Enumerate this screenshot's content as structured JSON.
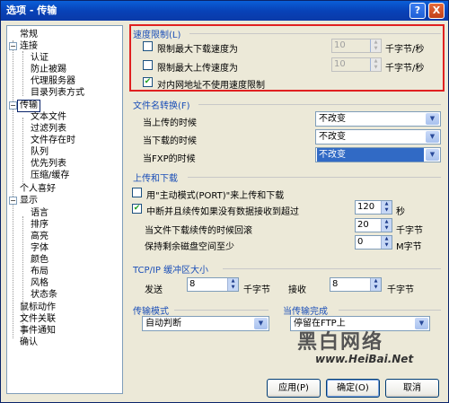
{
  "window": {
    "title": "选项 - 传输",
    "help_symbol": "?",
    "close_symbol": "X"
  },
  "tree": [
    {
      "label": "常规"
    },
    {
      "label": "连接"
    },
    {
      "label": "认证"
    },
    {
      "label": "防止被踢"
    },
    {
      "label": "代理服务器"
    },
    {
      "label": "目录列表方式"
    },
    {
      "label": "传输"
    },
    {
      "label": "文本文件"
    },
    {
      "label": "过滤列表"
    },
    {
      "label": "文件存在时"
    },
    {
      "label": "队列"
    },
    {
      "label": "优先列表"
    },
    {
      "label": "压缩/缓存"
    },
    {
      "label": "个人喜好"
    },
    {
      "label": "显示"
    },
    {
      "label": "语言"
    },
    {
      "label": "排序"
    },
    {
      "label": "高亮"
    },
    {
      "label": "字体"
    },
    {
      "label": "颜色"
    },
    {
      "label": "布局"
    },
    {
      "label": "风格"
    },
    {
      "label": "状态条"
    },
    {
      "label": "鼠标动作"
    },
    {
      "label": "文件关联"
    },
    {
      "label": "事件通知"
    },
    {
      "label": "确认"
    }
  ],
  "speed": {
    "title": "速度限制(L)",
    "max_download_label": "限制最大下载速度为",
    "max_download_value": "10",
    "max_upload_label": "限制最大上传速度为",
    "max_upload_value": "10",
    "unit": "千字节/秒",
    "no_limit_intranet_label": "对内网地址不使用速度限制",
    "max_download_checked": false,
    "max_upload_checked": false,
    "no_limit_intranet_checked": true
  },
  "conversion": {
    "title": "文件名转换(F)",
    "upload_label": "当上传的时候",
    "upload_value": "不改变",
    "download_label": "当下载的时候",
    "download_value": "不改变",
    "fxp_label": "当FXP的时候",
    "fxp_value": "不改变"
  },
  "transfer": {
    "title": "上传和下载",
    "active_mode_label": "用\"主动模式(PORT)\"来上传和下载",
    "active_mode_checked": false,
    "interrupt_label": "中断并且续传如果没有数据接收到超过",
    "interrupt_checked": true,
    "interrupt_value": "120",
    "interrupt_unit": "秒",
    "rollback_label": "当文件下载续传的时候回滚",
    "rollback_value": "20",
    "rollback_unit": "千字节",
    "reserve_label": "保持剩余磁盘空间至少",
    "reserve_value": "0",
    "reserve_unit": "M字节"
  },
  "buffer": {
    "title": "TCP/IP 缓冲区大小",
    "send_label": "发送",
    "send_value": "8",
    "send_unit": "千字节",
    "recv_label": "接收",
    "recv_value": "8",
    "recv_unit": "千字节"
  },
  "mode": {
    "title": "传输模式",
    "value": "自动判断",
    "complete_title": "当传输完成",
    "complete_value": "停留在FTP上"
  },
  "buttons": {
    "apply": "应用(P)",
    "ok": "确定(O)",
    "cancel": "取消"
  },
  "watermark": {
    "logo": "黑白网络",
    "url": "www.HeiBai.Net"
  },
  "colors": {
    "section_title": "#1b4fb8",
    "highlight_box": "#e02020",
    "selection": "#316ac5",
    "titlebar": "#0842b8"
  }
}
